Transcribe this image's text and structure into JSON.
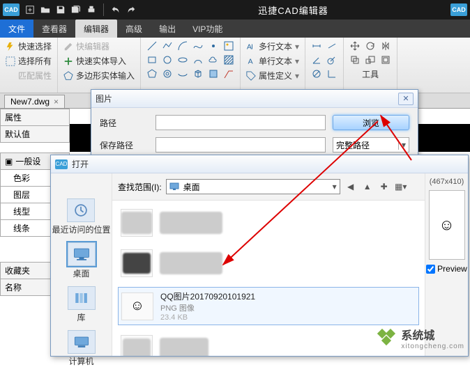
{
  "title": "迅捷CAD编辑器",
  "menus": {
    "file": "文件",
    "viewer": "查看器",
    "editor": "编辑器",
    "advanced": "高级",
    "output": "输出",
    "vip": "VIP功能"
  },
  "ribbon": {
    "quick_select": "快速选择",
    "select_all": "选择所有",
    "match_prop": "匹配属性",
    "quick_editor": "快编辑器",
    "quick_entity_import": "快速实体导入",
    "poly_entity_input": "多边形实体输入",
    "multiline_text": "多行文本",
    "single_text": "单行文本",
    "attr_def": "属性定义",
    "tools": "工具"
  },
  "doc_tab": "New7.dwg",
  "prop": {
    "panel": "属性",
    "default": "默认值",
    "general": "一般设",
    "c1": "色彩",
    "c2": "图层",
    "c3": "线型",
    "c4": "线条"
  },
  "fav": {
    "title": "收藏夹",
    "name": "名称"
  },
  "dlg_image": {
    "title": "图片",
    "path_label": "路径",
    "save_label": "保存路径",
    "browse": "浏览",
    "full_path": "完整路径"
  },
  "dlg_open": {
    "title": "打开",
    "lookin": "查找范围(I):",
    "desktop": "桌面",
    "places": {
      "recent": "最近访问的位置",
      "desktop": "桌面",
      "libs": "库",
      "computer": "计算机"
    },
    "file": {
      "name": "QQ图片20170920101921",
      "type": "PNG 图像",
      "size": "23.4 KB"
    },
    "dim": "(467x410)",
    "preview": "Preview"
  },
  "watermark": {
    "big": "系统城",
    "small": "xitongcheng.com"
  }
}
